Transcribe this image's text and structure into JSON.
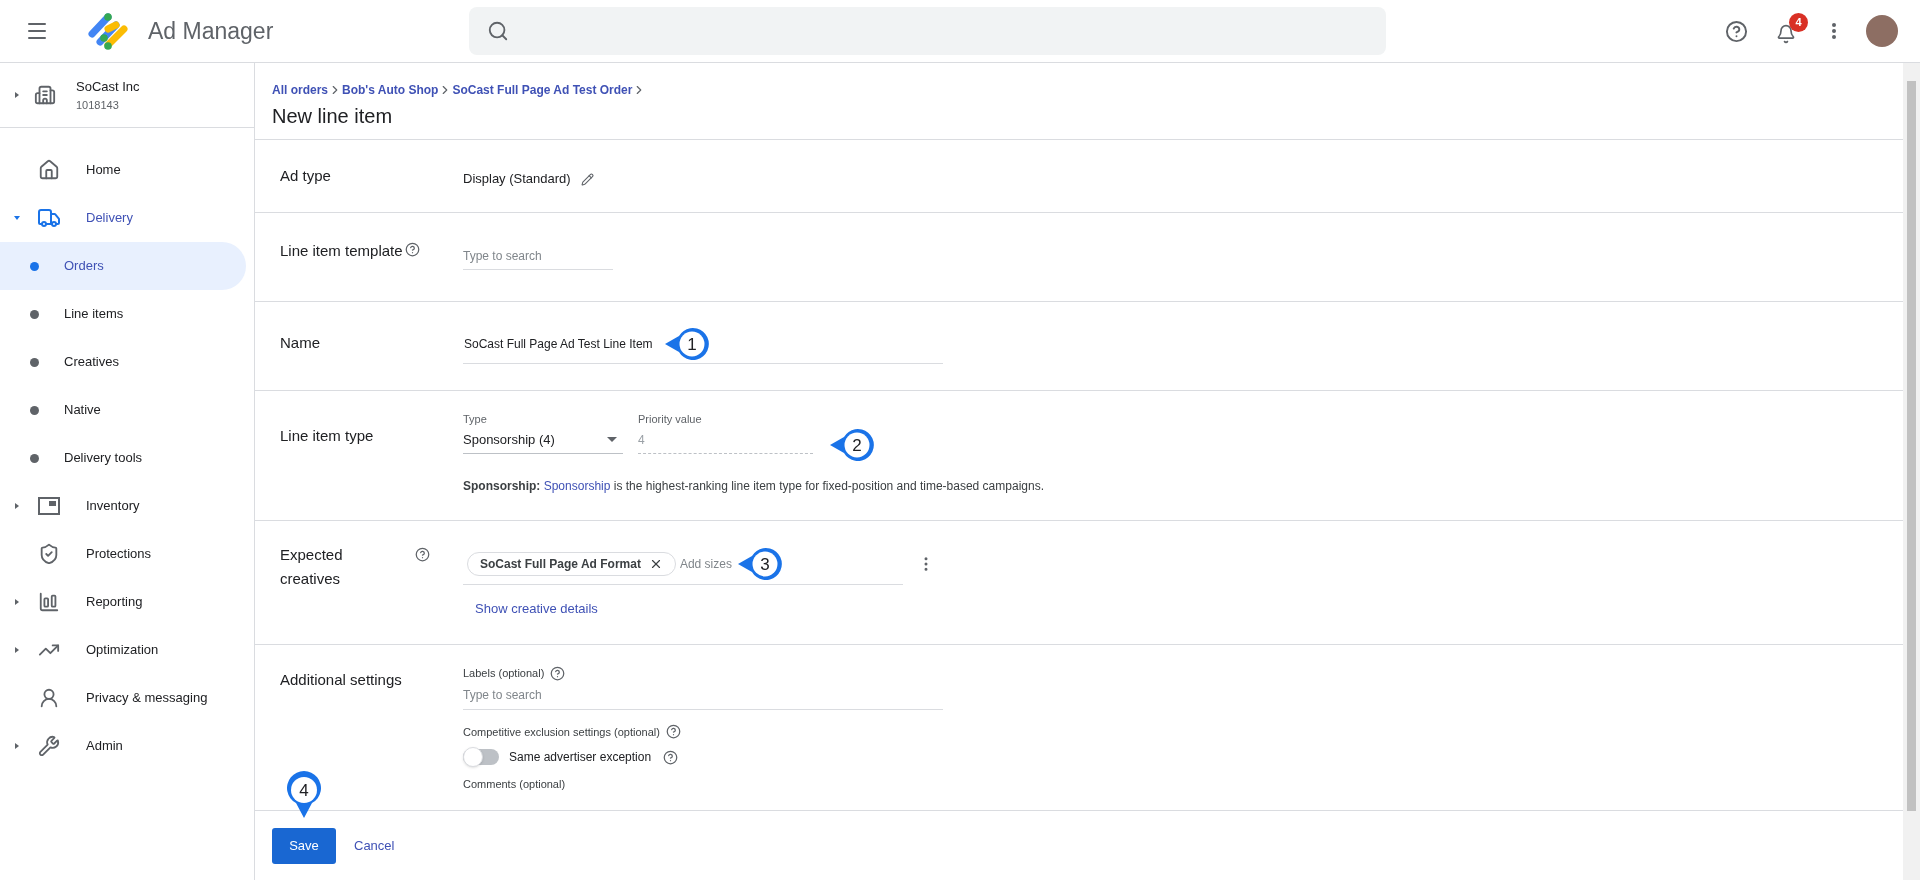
{
  "app_bar": {
    "title": "Ad Manager",
    "notifications_badge": "4"
  },
  "network": {
    "name": "SoCast Inc",
    "id": "1018143",
    "expanded": false
  },
  "sidebar": {
    "items": [
      {
        "label": "Home",
        "selected": false
      },
      {
        "label": "Delivery",
        "selected": false,
        "expanded": true,
        "children": [
          {
            "label": "Orders",
            "selected": true
          },
          {
            "label": "Line items",
            "selected": false
          },
          {
            "label": "Creatives",
            "selected": false
          },
          {
            "label": "Native",
            "selected": false
          },
          {
            "label": "Delivery tools",
            "selected": false
          }
        ]
      },
      {
        "label": "Inventory",
        "selected": false,
        "expanded": false
      },
      {
        "label": "Protections",
        "selected": false
      },
      {
        "label": "Reporting",
        "selected": false,
        "expanded": false
      },
      {
        "label": "Optimization",
        "selected": false,
        "expanded": false
      },
      {
        "label": "Privacy & messaging",
        "selected": false
      },
      {
        "label": "Admin",
        "selected": false,
        "expanded": false
      }
    ]
  },
  "breadcrumbs": [
    "All orders",
    "Bob's Auto Shop",
    "SoCast Full Page Ad Test Order"
  ],
  "page_title": "New line item",
  "form": {
    "ad_type": {
      "label": "Ad type",
      "value": "Display (Standard)"
    },
    "template": {
      "label": "Line item template",
      "placeholder": "Type to search"
    },
    "name": {
      "label": "Name",
      "value": "SoCast Full Page Ad Test Line Item",
      "callout": "1"
    },
    "line_item_type": {
      "label": "Line item type",
      "type_label": "Type",
      "type_value": "Sponsorship (4)",
      "priority_label": "Priority value",
      "priority_value": "4",
      "callout": "2",
      "help_bold": "Sponsorship:",
      "help_link": "Sponsorship",
      "help_text": "is the highest-ranking line item type for fixed-position and time-based campaigns."
    },
    "expected_creatives": {
      "label_lines": [
        "Expected",
        "creatives"
      ],
      "chips": [
        "SoCast Full Page Ad Format"
      ],
      "placeholder": "Add sizes",
      "callout": "3",
      "link": "Show creative details"
    },
    "additional": {
      "label": "Additional settings",
      "labels_label": "Labels (optional)",
      "labels_placeholder": "Type to search",
      "exclusion_label": "Competitive exclusion settings (optional)",
      "toggle_label": "Same advertiser exception",
      "toggle_on": false,
      "comments_label": "Comments (optional)"
    }
  },
  "footer": {
    "save": "Save",
    "cancel": "Cancel",
    "callout": "4"
  }
}
